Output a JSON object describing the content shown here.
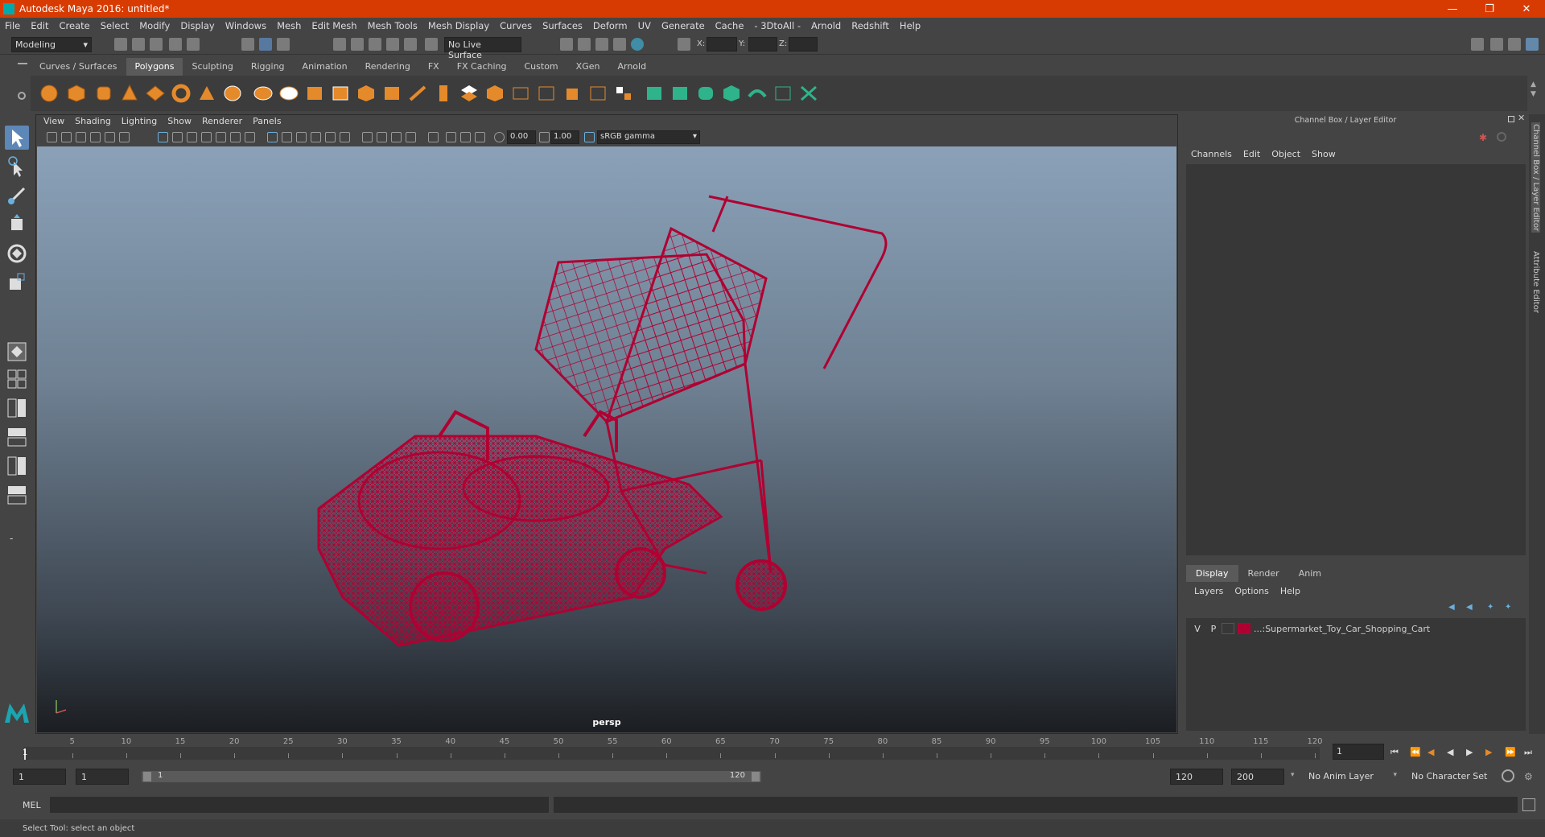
{
  "window": {
    "title": "Autodesk Maya 2016: untitled*"
  },
  "menubar": [
    "File",
    "Edit",
    "Create",
    "Select",
    "Modify",
    "Display",
    "Windows",
    "Mesh",
    "Edit Mesh",
    "Mesh Tools",
    "Mesh Display",
    "Curves",
    "Surfaces",
    "Deform",
    "UV",
    "Generate",
    "Cache",
    "- 3DtoAll -",
    "Arnold",
    "Redshift",
    "Help"
  ],
  "statusline": {
    "mode": "Modeling",
    "live_surface": "No Live Surface",
    "x_label": "X:",
    "y_label": "Y:",
    "z_label": "Z:"
  },
  "shelf_tabs": [
    "Curves / Surfaces",
    "Polygons",
    "Sculpting",
    "Rigging",
    "Animation",
    "Rendering",
    "FX",
    "FX Caching",
    "Custom",
    "XGen",
    "Arnold"
  ],
  "shelf_active": "Polygons",
  "viewport": {
    "menu": [
      "View",
      "Shading",
      "Lighting",
      "Show",
      "Renderer",
      "Panels"
    ],
    "exposure": "0.00",
    "gamma": "1.00",
    "color_space": "sRGB gamma",
    "camera_label": "persp",
    "wire_color": "#b00032"
  },
  "channel_box": {
    "title": "Channel Box / Layer Editor",
    "menu": [
      "Channels",
      "Edit",
      "Object",
      "Show"
    ]
  },
  "layer_editor": {
    "tabs": [
      "Display",
      "Render",
      "Anim"
    ],
    "active_tab": "Display",
    "menu": [
      "Layers",
      "Options",
      "Help"
    ],
    "layers": [
      {
        "v": "V",
        "p": "P",
        "name": "...:Supermarket_Toy_Car_Shopping_Cart",
        "color": "#b00032"
      }
    ]
  },
  "side_tabs": [
    "Channel Box / Layer Editor",
    "Attribute Editor"
  ],
  "timeline": {
    "ticks": [
      5,
      10,
      15,
      20,
      25,
      30,
      35,
      40,
      45,
      50,
      55,
      60,
      65,
      70,
      75,
      80,
      85,
      90,
      95,
      100,
      105,
      110,
      115,
      120
    ],
    "current_marker": "1",
    "current_frame": "1"
  },
  "range": {
    "start": "1",
    "playback_start": "1",
    "slider_start": "1",
    "slider_end": "120",
    "playback_end": "120",
    "end": "200",
    "anim_layer": "No Anim Layer",
    "character_set": "No Character Set"
  },
  "mel": {
    "label": "MEL"
  },
  "help": {
    "text": "Select Tool: select an object"
  }
}
